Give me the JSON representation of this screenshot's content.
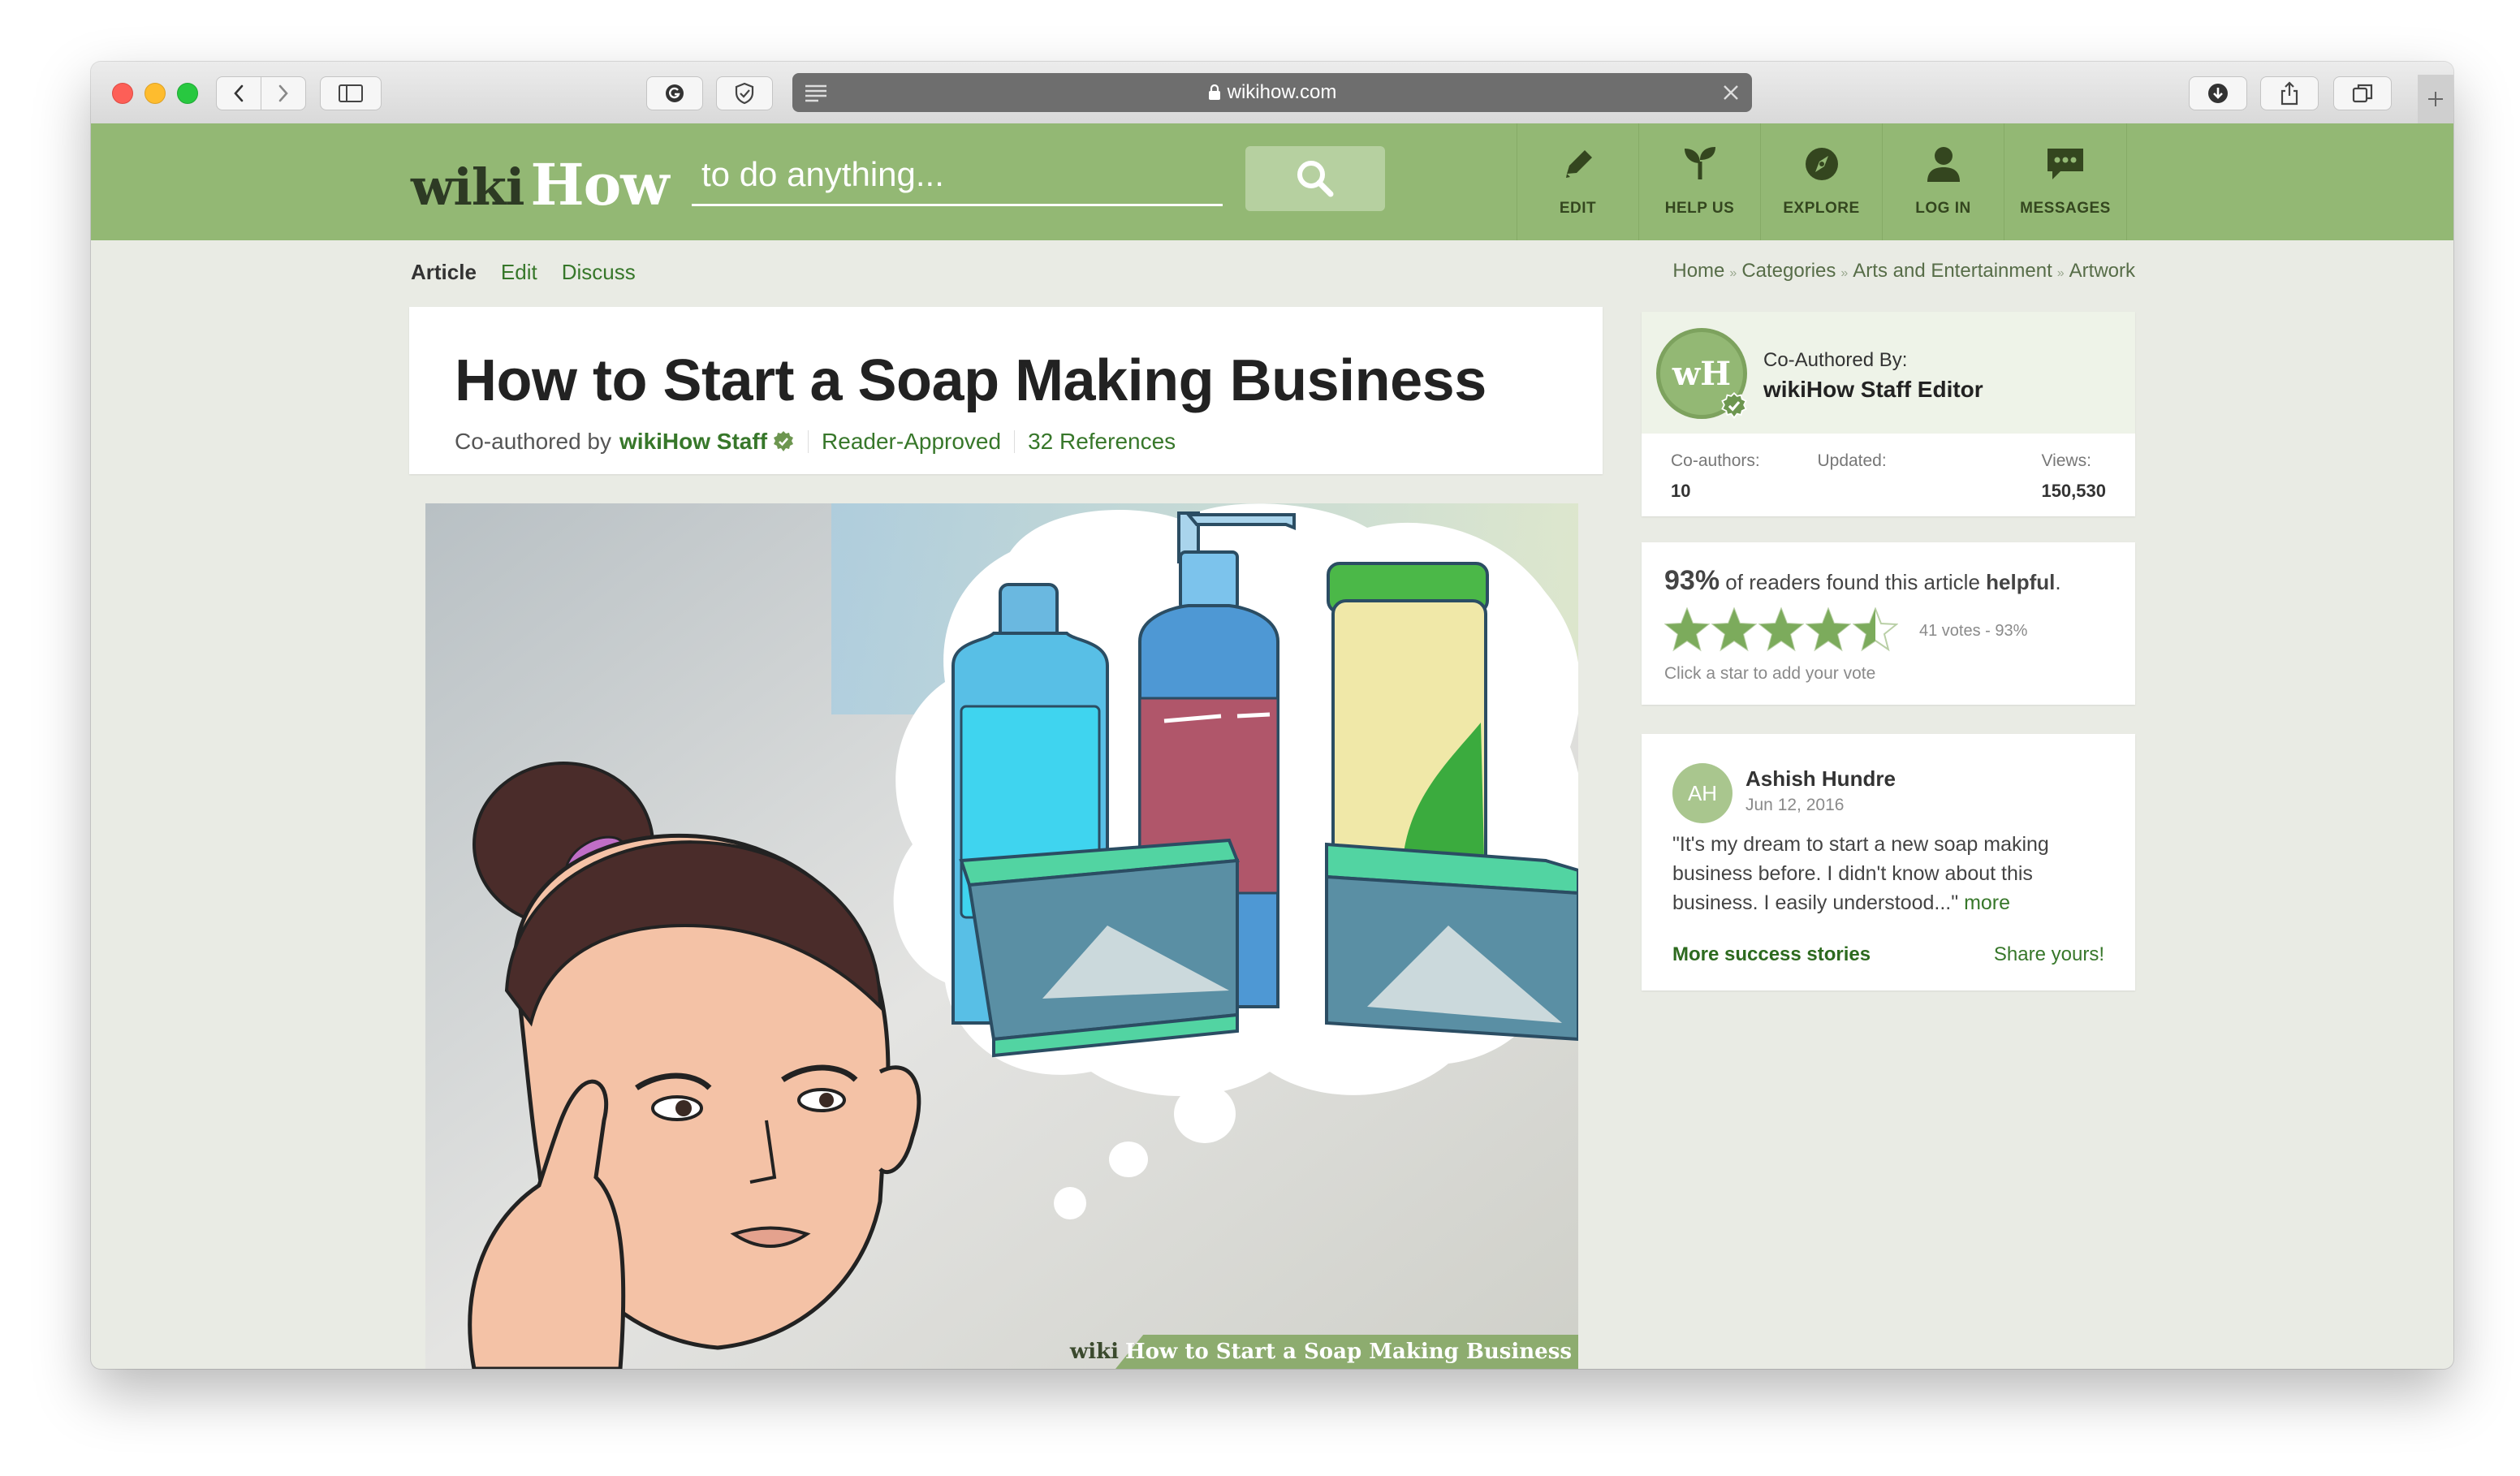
{
  "browser": {
    "url": "wikihow.com"
  },
  "site": {
    "logo_wiki": "wiki",
    "logo_how": "How",
    "search_placeholder": "to do anything...",
    "nav": [
      {
        "label": "EDIT",
        "icon": "pencil-icon"
      },
      {
        "label": "HELP US",
        "icon": "sprout-icon"
      },
      {
        "label": "EXPLORE",
        "icon": "compass-icon"
      },
      {
        "label": "LOG IN",
        "icon": "user-icon"
      },
      {
        "label": "MESSAGES",
        "icon": "chat-bubble-icon"
      }
    ]
  },
  "tabs": {
    "article": "Article",
    "edit": "Edit",
    "discuss": "Discuss"
  },
  "breadcrumb": [
    "Home",
    "Categories",
    "Arts and Entertainment",
    "Artwork"
  ],
  "article": {
    "title": "How to Start a Soap Making Business",
    "coauthored_prefix": "Co-authored by",
    "author": "wikiHow Staff",
    "reader_approved": "Reader-Approved",
    "references": "32 References",
    "image_caption_wiki": "wiki",
    "image_caption": "How to Start a Soap Making Business"
  },
  "coauthor_card": {
    "avatar_text": "wH",
    "by_label": "Co-Authored By:",
    "name": "wikiHow Staff Editor",
    "coauthors_label": "Co-authors:",
    "coauthors_value": "10",
    "updated_label": "Updated:",
    "views_label": "Views:",
    "views_value": "150,530"
  },
  "rating_card": {
    "percent": "93%",
    "text_mid": "of readers found this article",
    "text_bold": "helpful",
    "text_end": ".",
    "stars_filled": 4.5,
    "stars_total": 5,
    "votes": "41 votes - 93%",
    "hint": "Click a star to add your vote"
  },
  "story_card": {
    "initials": "AH",
    "name": "Ashish Hundre",
    "date": "Jun 12, 2016",
    "quote": "\"It's my dream to start a new soap making business before. I didn't know about this business. I easily understood...\"",
    "more": "more",
    "more_stories": "More success stories",
    "share": "Share yours!"
  },
  "colors": {
    "brand_green": "#93b874",
    "link_green": "#37772a",
    "star_green": "#7cab5c"
  }
}
